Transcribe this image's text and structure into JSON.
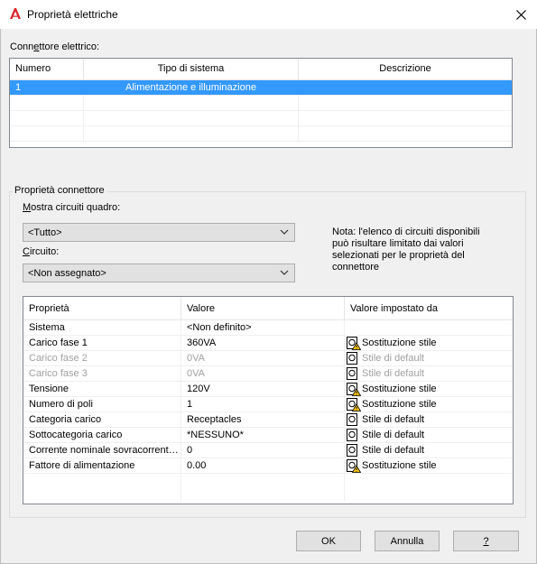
{
  "window": {
    "title": "Proprietà elettriche",
    "close_glyph": "✕",
    "icon": "autocad-a-icon"
  },
  "connector_section": {
    "label": "Connettore elettrico:",
    "columns": [
      "Numero",
      "Tipo di sistema",
      "Descrizione"
    ],
    "rows": [
      {
        "numero": "1",
        "tipo": "Alimentazione e illuminazione",
        "descrizione": "",
        "selected": true
      }
    ]
  },
  "properties_group": {
    "title": "Proprietà connettore",
    "show_circuits_label": "Mostra circuiti quadro:",
    "show_circuits_value": "<Tutto>",
    "circuit_label": "Circuito:",
    "circuit_value": "<Non assegnato>",
    "note": "Nota: l'elenco di circuiti disponibili può risultare limitato dai valori selezionati per le proprietà del connettore",
    "table": {
      "columns": [
        "Proprietà",
        "Valore",
        "Valore impostato da"
      ],
      "rows": [
        {
          "prop": "Sistema",
          "value": "<Non definito>",
          "source": "",
          "icon": "",
          "disabled": false
        },
        {
          "prop": "Carico fase 1",
          "value": "360VA",
          "source": "Sostituzione stile",
          "icon": "override-warning-icon",
          "disabled": false
        },
        {
          "prop": "Carico fase 2",
          "value": "0VA",
          "source": "Stile di default",
          "icon": "default-style-icon",
          "disabled": true
        },
        {
          "prop": "Carico fase 3",
          "value": "0VA",
          "source": "Stile di default",
          "icon": "default-style-icon",
          "disabled": true
        },
        {
          "prop": "Tensione",
          "value": "120V",
          "source": "Sostituzione stile",
          "icon": "override-warning-icon",
          "disabled": false
        },
        {
          "prop": "Numero di poli",
          "value": "1",
          "source": "Sostituzione stile",
          "icon": "override-warning-icon",
          "disabled": false
        },
        {
          "prop": "Categoria carico",
          "value": "Receptacles",
          "source": "Stile di default",
          "icon": "default-style-icon",
          "disabled": false
        },
        {
          "prop": "Sottocategoria carico",
          "value": "*NESSUNO*",
          "source": "Stile di default",
          "icon": "default-style-icon",
          "disabled": false
        },
        {
          "prop": "Corrente nominale sovracorrente...",
          "value": "0",
          "source": "Stile di default",
          "icon": "default-style-icon",
          "disabled": false
        },
        {
          "prop": "Fattore di alimentazione",
          "value": "0.00",
          "source": "Sostituzione stile",
          "icon": "override-warning-icon",
          "disabled": false
        }
      ]
    }
  },
  "buttons": {
    "ok": "OK",
    "cancel": "Annulla",
    "help": "?"
  },
  "colors": {
    "selection": "#3399ff",
    "dialog_bg": "#f0f0f0",
    "app_icon_red": "#d7262d",
    "warning_yellow": "#f5c400"
  }
}
